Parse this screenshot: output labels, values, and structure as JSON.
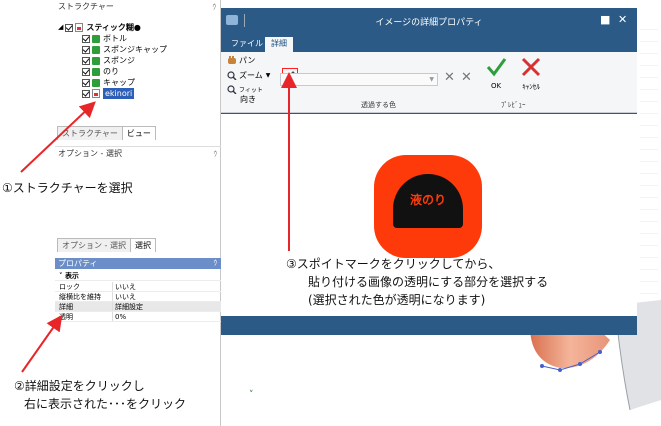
{
  "left_panel": {
    "header": "ストラクチャー",
    "pin": "ｳ",
    "tree": {
      "root_label": "スティック糊●",
      "items": [
        {
          "label": "ボトル"
        },
        {
          "label": "スポンジキャップ"
        },
        {
          "label": "スポンジ"
        },
        {
          "label": "のり"
        },
        {
          "label": "キャップ"
        },
        {
          "label": "ekinori"
        }
      ]
    },
    "tabs": [
      "ストラクチャー",
      "ビュー"
    ],
    "options_header": "オプション - 選択",
    "bottom_tabs": [
      "オプション - 選択",
      "選択"
    ],
    "properties": {
      "header": "プロパティ",
      "section": "表示",
      "rows": [
        {
          "key": "ロック",
          "value": "いいえ"
        },
        {
          "key": "縦横比を維持",
          "value": "いいえ"
        },
        {
          "key": "詳細",
          "value": "詳細設定"
        },
        {
          "key": "透明",
          "value": "0%"
        }
      ]
    }
  },
  "dialog": {
    "title": "イメージの詳細プロパティ",
    "tabs": [
      {
        "label": "ファイル"
      },
      {
        "label": "詳細"
      }
    ],
    "ribbon": {
      "pan_label": "パン",
      "zoom_label": "ズーム",
      "fit_label": "フィット",
      "fit_label2": "向き",
      "transparent_color_label": "透過する色",
      "ok_label": "OK",
      "cancel_label": "ｷｬﾝｾﾙ",
      "preview_group_label": "ﾌﾟﾚﾋﾞｭｰ"
    },
    "preview_text": "液のり"
  },
  "annotations": {
    "step1": "①ストラクチャーを選択",
    "step2_line1": "②詳細設定をクリックし",
    "step2_line2": "右に表示された･･･をクリック",
    "step3_line1": "③スポイトマークをクリックしてから、",
    "step3_line2": "貼り付ける画像の透明にする部分を選択する",
    "step3_line3": "(選択された色が透明になります)"
  },
  "colors": {
    "dialog_frame": "#2b5a87",
    "annotation_arrow": "#e8262a",
    "preview_orange": "#ff3a0a",
    "ok_green": "#2e9e3a",
    "cancel_red": "#d63232"
  }
}
